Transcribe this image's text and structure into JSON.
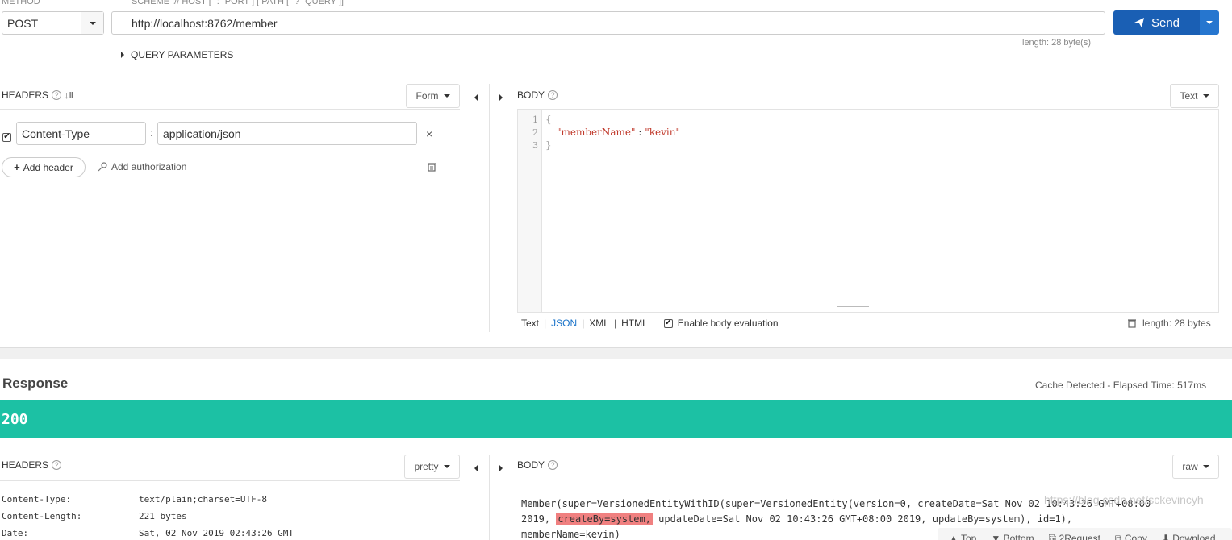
{
  "request": {
    "method_label": "METHOD",
    "url_label": "SCHEME :// HOST [ \":\" PORT ] [ PATH [ \"?\" QUERY ]]",
    "method": "POST",
    "url": "http://localhost:8762/member",
    "send_label": "Send",
    "length": "length: 28 byte(s)",
    "query_parameters": "QUERY PARAMETERS"
  },
  "headers_panel": {
    "title": "HEADERS",
    "mode": "Form",
    "header_key": "Content-Type",
    "header_value": "application/json",
    "add_header": "Add header",
    "add_authorization": "Add authorization"
  },
  "body_panel": {
    "title": "BODY",
    "mode": "Text",
    "line_numbers": [
      "1",
      "2",
      "3"
    ],
    "line1": "{",
    "key": "\"memberName\"",
    "colon": " : ",
    "value": "\"kevin\"",
    "line3": "}",
    "formats": [
      "Text",
      "JSON",
      "XML",
      "HTML"
    ],
    "enable_eval": "Enable body evaluation",
    "length": "length: 28 bytes"
  },
  "response": {
    "title": "Response",
    "cache": "Cache Detected - Elapsed Time: 517ms",
    "status": "200",
    "headers_title": "HEADERS",
    "headers_mode": "pretty",
    "headers": [
      {
        "name": "Content-Type:",
        "value": "text/plain;charset=UTF-8"
      },
      {
        "name": "Content-Length:",
        "value": "221 bytes"
      },
      {
        "name": "Date:",
        "value": "Sat, 02 Nov 2019 02:43:26 GMT"
      }
    ],
    "body_title": "BODY",
    "body_mode": "raw",
    "body_line1": "Member(super=VersionedEntityWithID(super=VersionedEntity(version=0, createDate=Sat Nov 02 10:43:26 GMT+08:00",
    "body_line2_a": "2019, ",
    "body_line2_hl": "createBy=system,",
    "body_line2_b": " updateDate=Sat Nov 02 10:43:26 GMT+08:00 2019, updateBy=system), id=1),",
    "body_line3": "memberName=kevin)",
    "tools": [
      "Top",
      "Bottom",
      "2Request",
      "Copy",
      "Download"
    ],
    "watermark": "https://blog.csdn.net/sckevincyh"
  },
  "colors": {
    "send": "#1a5fb4",
    "status_bar": "#1cc1a4",
    "highlight": "#f08080",
    "json_active": "#1a73c9"
  }
}
